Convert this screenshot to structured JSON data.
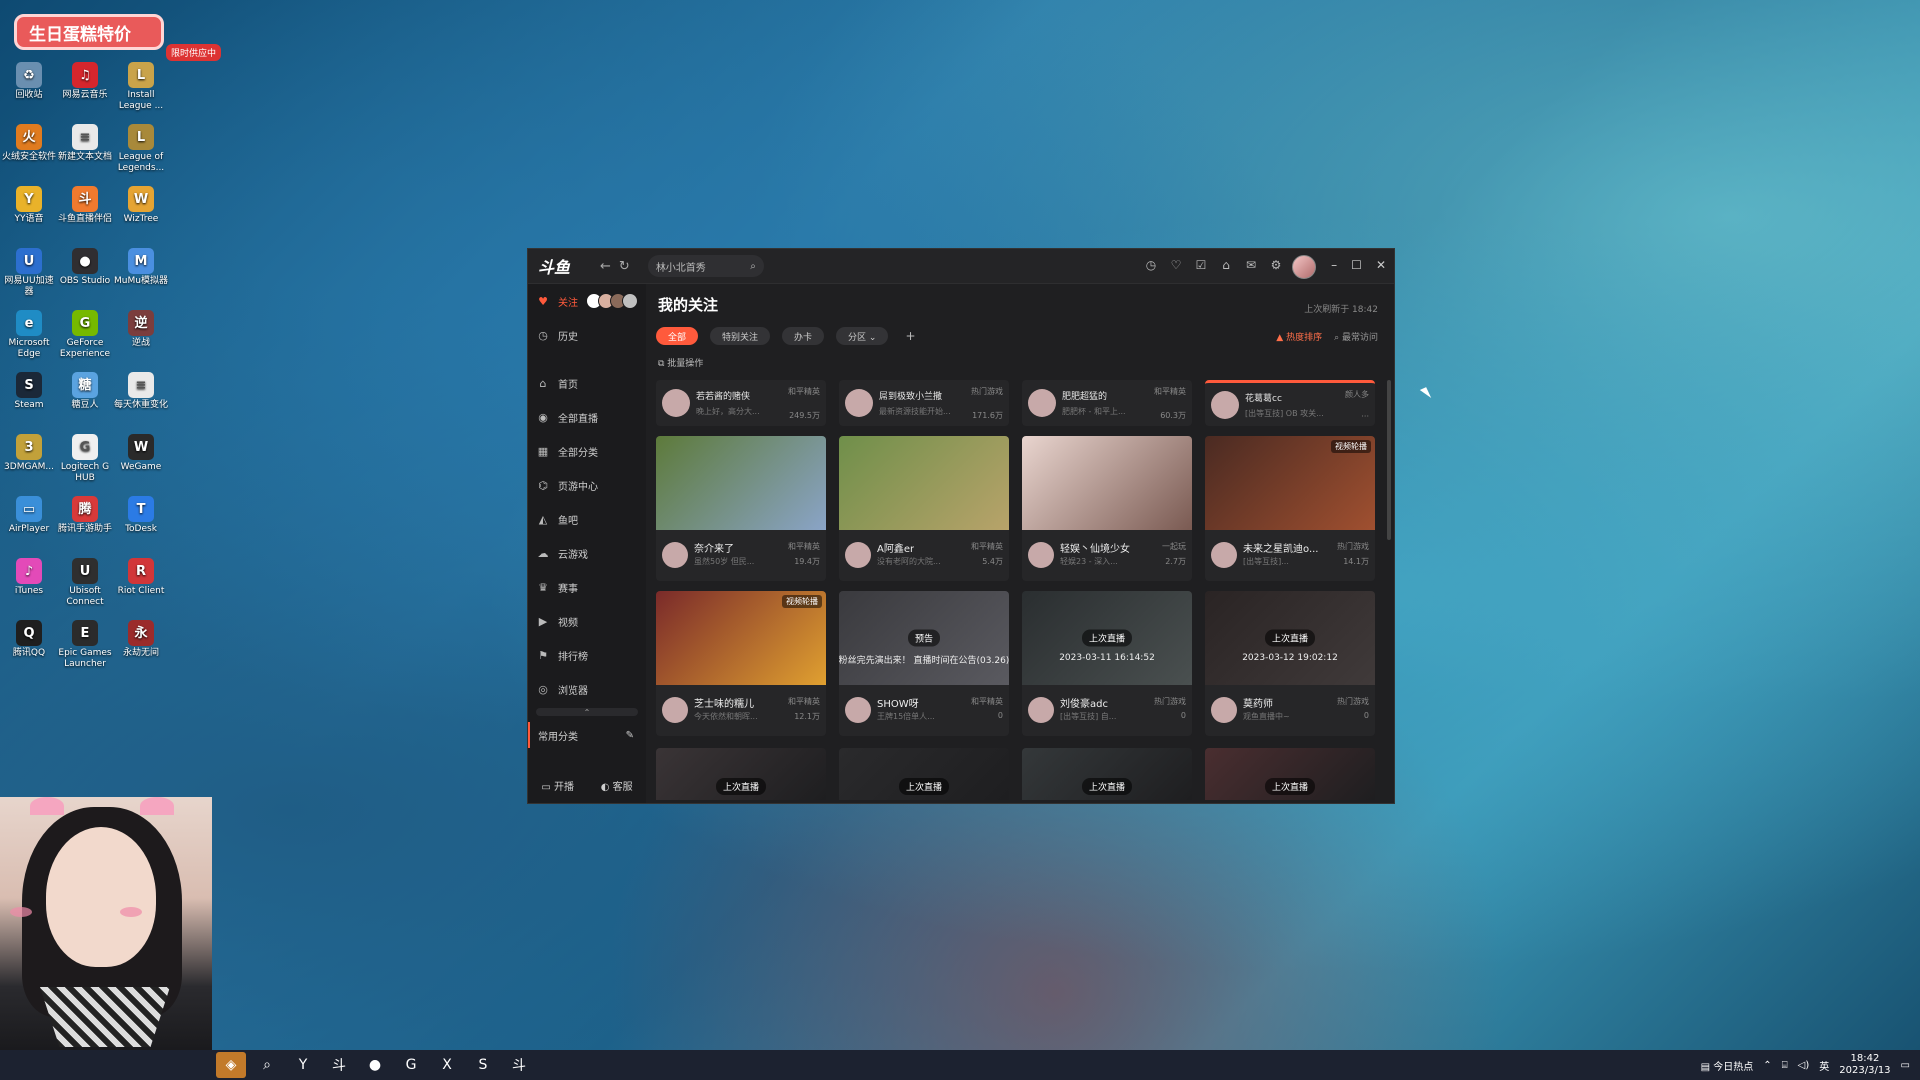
{
  "desktop": {
    "promo": {
      "text": "生日蛋糕特价",
      "tag": "限时供应中"
    },
    "icons": [
      {
        "label": "回收站",
        "icon": "recycle-bin-icon",
        "color": "#6a8fb0",
        "glyph": "♻"
      },
      {
        "label": "网易云音乐",
        "icon": "netease-music-icon",
        "color": "#d6262d",
        "glyph": "♫"
      },
      {
        "label": "Install League ...",
        "icon": "league-installer-icon",
        "color": "#c9a34a",
        "glyph": "L"
      },
      {
        "label": "火绒安全软件",
        "icon": "huorong-icon",
        "color": "#e07b1f",
        "glyph": "火"
      },
      {
        "label": "新建文本文档",
        "icon": "text-file-icon",
        "color": "#e9e9e9",
        "glyph": "≡"
      },
      {
        "label": "League of Legends...",
        "icon": "league-of-legends-icon",
        "color": "#a8893a",
        "glyph": "L"
      },
      {
        "label": "YY语音",
        "icon": "yy-voice-icon",
        "color": "#e9b22a",
        "glyph": "Y"
      },
      {
        "label": "斗鱼直播伴侣",
        "icon": "douyu-companion-icon",
        "color": "#f07a2e",
        "glyph": "斗"
      },
      {
        "label": "WizTree",
        "icon": "wiztree-icon",
        "color": "#e5a433",
        "glyph": "W"
      },
      {
        "label": "网易UU加速器",
        "icon": "uu-accelerator-icon",
        "color": "#2c6fcf",
        "glyph": "U"
      },
      {
        "label": "OBS Studio",
        "icon": "obs-icon",
        "color": "#302e31",
        "glyph": "●"
      },
      {
        "label": "MuMu模拟器",
        "icon": "mumu-icon",
        "color": "#4a8fe0",
        "glyph": "M"
      },
      {
        "label": "Microsoft Edge",
        "icon": "edge-icon",
        "color": "#1f8cc5",
        "glyph": "e"
      },
      {
        "label": "GeForce Experience",
        "icon": "geforce-icon",
        "color": "#76b900",
        "glyph": "G"
      },
      {
        "label": "逆战",
        "icon": "nizhan-icon",
        "color": "#7b3d3d",
        "glyph": "逆"
      },
      {
        "label": "Steam",
        "icon": "steam-icon",
        "color": "#1b2838",
        "glyph": "S"
      },
      {
        "label": "糖豆人",
        "icon": "fall-guys-icon",
        "color": "#5aa3e0",
        "glyph": "糖"
      },
      {
        "label": "每天休重变化",
        "icon": "text-file-icon",
        "color": "#e9e9e9",
        "glyph": "≡"
      },
      {
        "label": "3DMGAM...",
        "icon": "3dm-icon",
        "color": "#c2a13a",
        "glyph": "3"
      },
      {
        "label": "Logitech G HUB",
        "icon": "logitech-icon",
        "color": "#f0f0f0",
        "glyph": "G"
      },
      {
        "label": "WeGame",
        "icon": "wegame-icon",
        "color": "#2a2a2a",
        "glyph": "W"
      },
      {
        "label": "AirPlayer",
        "icon": "airplayer-icon",
        "color": "#3a8fd9",
        "glyph": "▭"
      },
      {
        "label": "腾讯手游助手",
        "icon": "tencent-mobile-icon",
        "color": "#d83a3a",
        "glyph": "腾"
      },
      {
        "label": "ToDesk",
        "icon": "todesk-icon",
        "color": "#2b7be5",
        "glyph": "T"
      },
      {
        "label": "iTunes",
        "icon": "itunes-icon",
        "color": "#e34ab8",
        "glyph": "♪"
      },
      {
        "label": "Ubisoft Connect",
        "icon": "ubisoft-icon",
        "color": "#2f2f2f",
        "glyph": "U"
      },
      {
        "label": "Riot Client",
        "icon": "riot-icon",
        "color": "#d13639",
        "glyph": "R"
      },
      {
        "label": "腾讯QQ",
        "icon": "qq-icon",
        "color": "#1f1f1f",
        "glyph": "Q"
      },
      {
        "label": "Epic Games Launcher",
        "icon": "epic-games-icon",
        "color": "#2b2b2b",
        "glyph": "E"
      },
      {
        "label": "永劫无间",
        "icon": "naraka-icon",
        "color": "#9b2b2b",
        "glyph": "永"
      }
    ]
  },
  "taskbar": {
    "apps": [
      {
        "icon": "start-icon",
        "glyph": "◈"
      },
      {
        "icon": "search-icon",
        "glyph": "⌕"
      },
      {
        "icon": "yy-voice-icon",
        "glyph": "Y"
      },
      {
        "icon": "douyu-icon",
        "glyph": "斗"
      },
      {
        "icon": "obs-icon",
        "glyph": "●"
      },
      {
        "icon": "geforce-icon",
        "glyph": "G"
      },
      {
        "icon": "xbox-icon",
        "glyph": "X"
      },
      {
        "icon": "steam-icon",
        "glyph": "S"
      },
      {
        "icon": "douyu-client-icon",
        "glyph": "斗"
      }
    ],
    "news": "今日热点",
    "lang": "英",
    "time": "18:42",
    "date": "2023/3/13"
  },
  "app": {
    "logo": "斗鱼",
    "search_text": "林小北首秀",
    "nav": [
      {
        "label": "关注",
        "icon": "heart-icon"
      },
      {
        "label": "历史",
        "icon": "clock-icon"
      },
      {
        "label": "首页",
        "icon": "home-icon"
      },
      {
        "label": "全部直播",
        "icon": "live-icon"
      },
      {
        "label": "全部分类",
        "icon": "grid-icon"
      },
      {
        "label": "页游中心",
        "icon": "gamepad-icon"
      },
      {
        "label": "鱼吧",
        "icon": "fish-icon"
      },
      {
        "label": "云游戏",
        "icon": "cloud-game-icon"
      },
      {
        "label": "赛事",
        "icon": "trophy-icon"
      },
      {
        "label": "视频",
        "icon": "video-icon"
      },
      {
        "label": "排行榜",
        "icon": "ranking-icon"
      },
      {
        "label": "浏览器",
        "icon": "browser-icon"
      }
    ],
    "common_category": "常用分类",
    "bottom": {
      "broadcast": "开播",
      "service": "客服"
    },
    "main": {
      "title": "我的关注",
      "last_refresh": "上次刷新于 18:42",
      "filters": [
        "全部",
        "特别关注",
        "办卡",
        "分区 ⌄"
      ],
      "sort_hot": "热度排序",
      "sort_recent": "最常访问",
      "batch": "批量操作"
    },
    "top_cards": [
      {
        "name": "若若酱的赌侠",
        "cat": "和平精英",
        "desc": "晚上好，高分大...",
        "hot": "249.5万"
      },
      {
        "name": "屌到极致小兰撒",
        "cat": "热门游戏",
        "desc": "最新资源技能开始...",
        "hot": "171.6万"
      },
      {
        "name": "肥肥超猛的",
        "cat": "和平精英",
        "desc": "肥肥杯 - 和平上...",
        "hot": "60.3万"
      },
      {
        "name": "花葛葛cc",
        "cat": "颜人多",
        "desc": "[出等互技] OB 攻关...",
        "hot": "···"
      }
    ],
    "cards_row1": [
      {
        "name": "奈介来了",
        "cat": "和平精英",
        "desc": "虽然50岁 但民...",
        "hot": "19.4万",
        "thumb": "#5d7a3a",
        "thumb2": "#8aa4c7"
      },
      {
        "name": "A阿鑫er",
        "cat": "和平精英",
        "desc": "没有老阿的大院...",
        "hot": "5.4万",
        "thumb": "#6f8f4a",
        "thumb2": "#b8a36a"
      },
      {
        "name": "轻娱丶仙境少女",
        "cat": "一起玩",
        "desc": "轻娱23 - 深入...",
        "hot": "2.7万",
        "thumb": "#e9d5cf",
        "thumb2": "#7a5a52"
      },
      {
        "name": "未来之星凯迪o...",
        "cat": "热门游戏",
        "desc": "[出等互技]...",
        "hot": "14.1万",
        "thumb": "#4a2a22",
        "thumb2": "#a05030",
        "vtag": "视频轮播"
      }
    ],
    "cards_row2": [
      {
        "name": "芝士味的糯儿",
        "cat": "和平精英",
        "desc": "今天依然和朝晖...",
        "hot": "12.1万",
        "thumb": "#7a2a2a",
        "thumb2": "#e0a030",
        "vtag": "视频轮播"
      },
      {
        "name": "SHOW呀",
        "cat": "和平精英",
        "desc": "王牌15倍单人...",
        "hot": "0",
        "thumb": "#3a3a3e",
        "thumb2": "#5a5a60",
        "badge": "预告",
        "ts": "粉丝完先演出来！ 直播时间在公告(03.26)"
      },
      {
        "name": "刘俊豪adc",
        "cat": "热门游戏",
        "desc": "[出等互技] 自...",
        "hot": "0",
        "thumb": "#2a2e30",
        "thumb2": "#4a5050",
        "badge": "上次直播",
        "ts": "2023-03-11 16:14:52"
      },
      {
        "name": "莫药师",
        "cat": "热门游戏",
        "desc": "观鱼直播中~",
        "hot": "0",
        "thumb": "#2a2424",
        "thumb2": "#403a3a",
        "badge": "上次直播",
        "ts": "2023-03-12 19:02:12"
      }
    ],
    "cards_row3": [
      {
        "badge": "上次直播",
        "thumb": "#3a3436"
      },
      {
        "badge": "上次直播",
        "thumb": "#2a2a2c"
      },
      {
        "badge": "上次直播",
        "thumb": "#34383a"
      },
      {
        "badge": "上次直播",
        "thumb": "#4a2e30"
      }
    ]
  }
}
